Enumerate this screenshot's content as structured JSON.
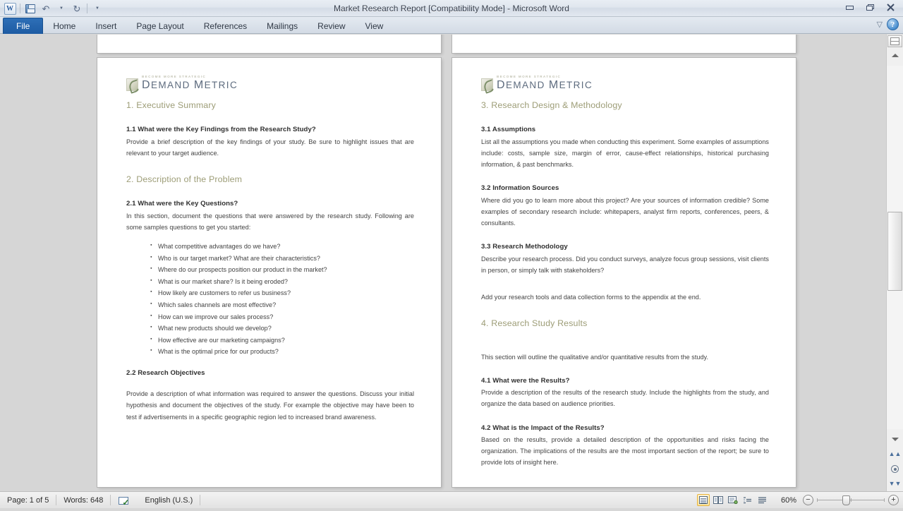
{
  "window": {
    "title": "Market Research Report [Compatibility Mode]  -  Microsoft Word",
    "quick_access": [
      {
        "name": "word-app-icon",
        "label": "W"
      },
      {
        "name": "save-icon",
        "label": "Save"
      },
      {
        "name": "undo-icon",
        "label": "Undo"
      },
      {
        "name": "redo-icon",
        "label": "Redo"
      },
      {
        "name": "customize-qat-icon",
        "label": "Customize Quick Access Toolbar"
      }
    ],
    "controls": {
      "minimize": "Minimize",
      "restore": "Restore Down",
      "close": "Close",
      "collapse_ribbon": "Minimize the Ribbon",
      "help": "?"
    }
  },
  "ribbon": {
    "tabs": [
      {
        "label": "File",
        "active": true
      },
      {
        "label": "Home",
        "active": false
      },
      {
        "label": "Insert",
        "active": false
      },
      {
        "label": "Page Layout",
        "active": false
      },
      {
        "label": "References",
        "active": false
      },
      {
        "label": "Mailings",
        "active": false
      },
      {
        "label": "Review",
        "active": false
      },
      {
        "label": "View",
        "active": false
      }
    ]
  },
  "document": {
    "logo": {
      "tagline": "BECOME MORE STRATEGIC",
      "name_part1": "D",
      "name_rest1": "EMAND ",
      "name_part2": "M",
      "name_rest2": "ETRIC"
    },
    "left_page": {
      "h1_a": "1. Executive Summary",
      "s11_heading": "1.1 What were the Key Findings from the Research  Study?",
      "s11_body": "Provide a brief description of the key findings of your study.  Be sure to highlight issues that are relevant to your target audience.",
      "h1_b": "2. Description of the Problem",
      "s21_heading": "2.1 What were the Key Questions?",
      "s21_body": "In  this  section,  document  the  questions  that  were  answered  by  the  research  study.  Following are some samples questions to get you started:",
      "bullets": [
        "What competitive advantages do we have?",
        "Who is our target market?  What are their characteristics?",
        "Where do our prospects position our product in the market?",
        "What is our market share?  Is it being eroded?",
        "How likely are customers to refer us business?",
        "Which sales channels are most effective?",
        "How can we improve our sales process?",
        "What new products should we develop?",
        "How effective are our marketing campaigns?",
        "What is the optimal price for our products?"
      ],
      "s22_heading": "2.2 Research  Objectives",
      "s22_body": "Provide a description of what information was required to answer the questions.  Discuss your  initial  hypothesis  and  document  the  objectives  of  the  study.   For  example  the objective may have been to test if advertisements in a specific geographic region led to increased brand awareness."
    },
    "right_page": {
      "h1_a": "3. Research Design & Methodology",
      "s31_heading": "3.1 Assumptions",
      "s31_body": "List all the assumptions you made when conducting this experiment.  Some examples of assumptions  include:  costs,  sample  size,  margin  of  error,  cause-effect  relationships, historical purchasing information, & past benchmarks.",
      "s32_heading": "3.2 Information Sources",
      "s32_body": "Where  did  you  go  to  learn  more  about  this  project?   Are  your  sources  of  information credible? Some examples of secondary research include: whitepapers,  analyst firm reports, conferences, peers, & consultants.",
      "s33_heading": "3.3 Research  Methodology",
      "s33_body": "Describe your research process.  Did you conduct surveys, analyze focus group sessions, visit clients in person, or simply talk with stakeholders?",
      "appendix_note": "Add your research tools and data collection forms to the appendix at the end.",
      "h1_b": "4. Research Study Results",
      "intro": "This section will outline the qualitative and/or quantitative results from the study.",
      "s41_heading": "4.1 What were the Results?",
      "s41_body": "Provide a description of the results of the research study.  Include the highlights from the study, and organize the data based on audience priorities.",
      "s42_heading": "4.2 What is the Impact of the Results?",
      "s42_body": "Based on the results, provide a detailed description of the opportunities and risks facing the  organization.   The  implications  of  the  results  are  the  most  important  section  of  the report; be sure to provide lots of insight here."
    }
  },
  "status_bar": {
    "page": "Page: 1 of 5",
    "words": "Words: 648",
    "proofing_icon": "spell-check-icon",
    "language": "English (U.S.)",
    "view_buttons": [
      {
        "name": "print-layout-view",
        "active": true
      },
      {
        "name": "full-screen-reading-view",
        "active": false
      },
      {
        "name": "web-layout-view",
        "active": false
      },
      {
        "name": "outline-view",
        "active": false
      },
      {
        "name": "draft-view",
        "active": false
      }
    ],
    "zoom_level": "60%",
    "zoom_out": "−",
    "zoom_in": "+"
  },
  "scrollbar": {
    "split_icon": "split-window-icon",
    "up_arrow": "scroll-up-icon",
    "down_arrow": "scroll-down-icon",
    "previous_page": "previous-page-icon",
    "select_browse_object": "select-browse-object-icon",
    "next_page": "next-page-icon"
  },
  "colors": {
    "heading_olive": "#9d9d77",
    "file_tab_blue": "#1d5ba3",
    "body_gray": "#434343"
  }
}
